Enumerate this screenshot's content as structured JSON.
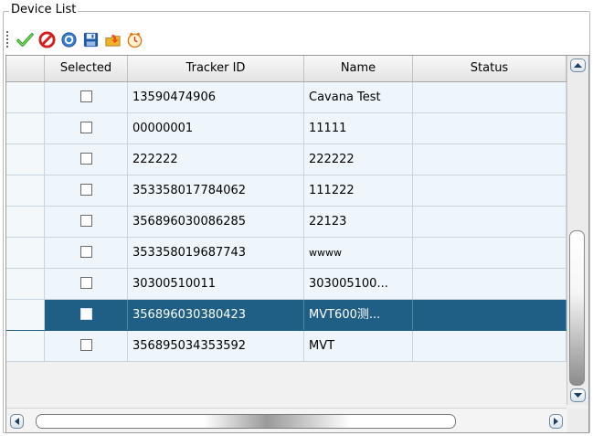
{
  "group": {
    "title": "Device List"
  },
  "toolbar": {
    "icons": [
      "check-icon",
      "cancel-icon",
      "refresh-icon",
      "save-icon",
      "export-icon",
      "clock-icon"
    ]
  },
  "table": {
    "columns": [
      "",
      "Selected",
      "Tracker ID",
      "Name",
      "Status"
    ],
    "rows": [
      {
        "tracker_id": "13590474906",
        "name": "Cavana Test",
        "status": "",
        "checked": false
      },
      {
        "tracker_id": "00000001",
        "name": "11111",
        "status": "",
        "checked": false
      },
      {
        "tracker_id": "222222",
        "name": "222222",
        "status": "",
        "checked": false
      },
      {
        "tracker_id": "353358017784062",
        "name": "111222",
        "status": "",
        "checked": false
      },
      {
        "tracker_id": "356896030086285",
        "name": "22123",
        "status": "",
        "checked": false
      },
      {
        "tracker_id": "353358019687743",
        "name": "wwww",
        "status": "",
        "checked": false
      },
      {
        "tracker_id": "30300510011",
        "name": "303005100...",
        "status": "",
        "checked": false
      },
      {
        "tracker_id": "356896030380423",
        "name": "MVT600测...",
        "status": "",
        "checked": false,
        "selected": true
      },
      {
        "tracker_id": "356895034353592",
        "name": "MVT",
        "status": "",
        "checked": false
      }
    ]
  },
  "colors": {
    "selected_row": "#1f5f85",
    "row_bg": "#eef6fb",
    "grid_line": "#c8d4de"
  }
}
